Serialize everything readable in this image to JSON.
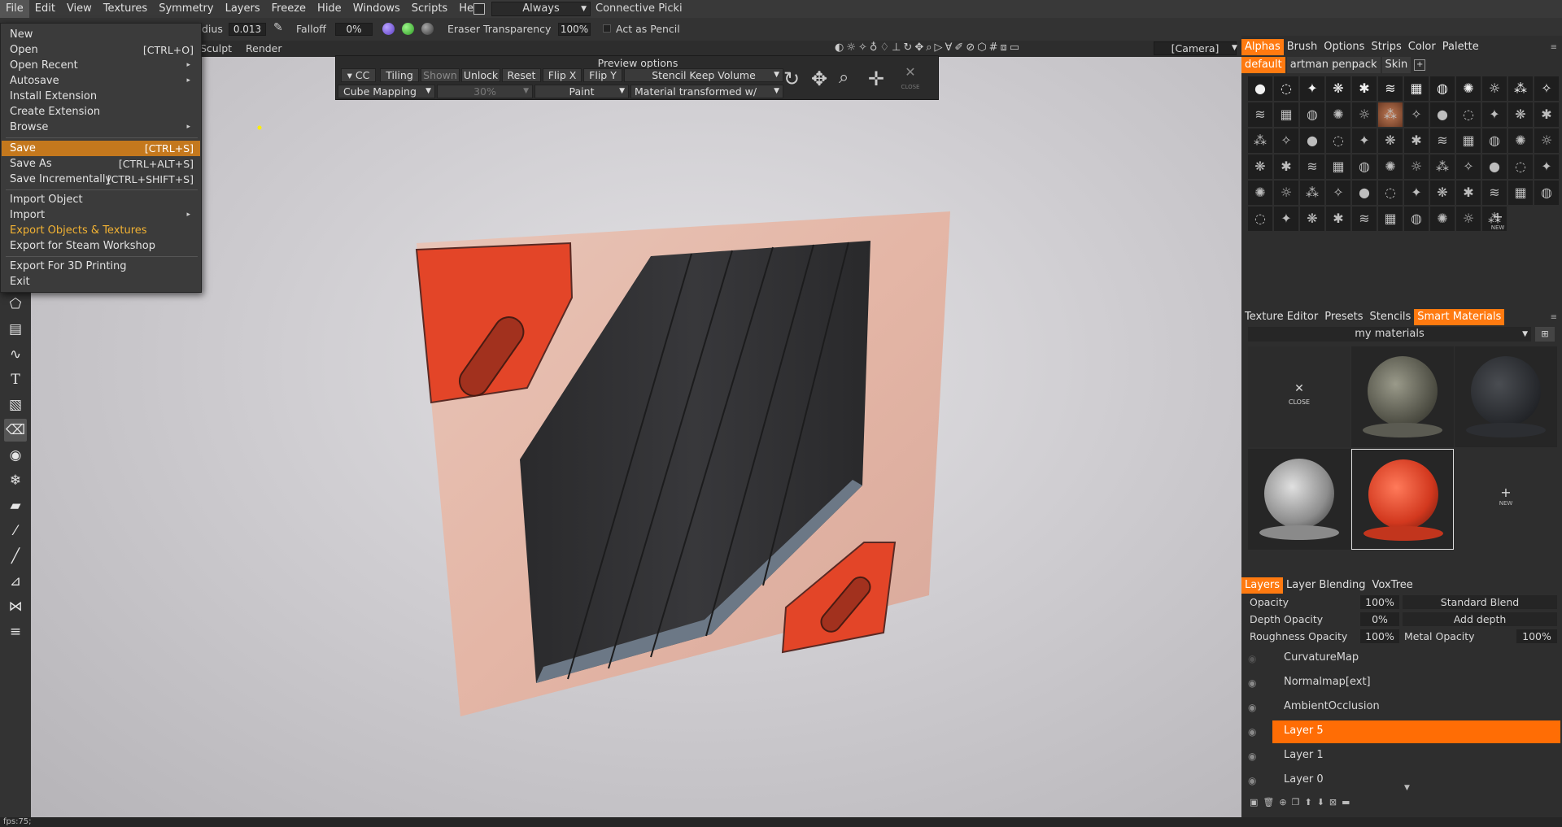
{
  "menubar": [
    "File",
    "Edit",
    "View",
    "Textures",
    "Symmetry",
    "Layers",
    "Freeze",
    "Hide",
    "Windows",
    "Scripts",
    "Help"
  ],
  "toolbar": {
    "always": "Always",
    "connective": "Connective Picki",
    "radius_label": "dius",
    "radius_value": "0.013",
    "falloff_label": "Falloff",
    "falloff_value": "0%",
    "eraser_label": "Eraser Transparency",
    "eraser_value": "100%",
    "pencil_label": "Act as Pencil",
    "camera": "[Camera]",
    "sculpt": "Sculpt",
    "render": "Render"
  },
  "file_menu": {
    "new": "New",
    "open": "Open",
    "open_sc": "[CTRL+O]",
    "open_recent": "Open Recent",
    "autosave": "Autosave",
    "install_ext": "Install Extension",
    "create_ext": "Create Extension",
    "browse": "Browse",
    "save": "Save",
    "save_sc": "[CTRL+S]",
    "save_as": "Save As",
    "save_as_sc": "[CTRL+ALT+S]",
    "save_inc": "Save Incrementally",
    "save_inc_sc": "[CTRL+SHIFT+S]",
    "import_object": "Import Object",
    "import": "Import",
    "export_obj_tex": "Export Objects & Textures",
    "export_steam": "Export for Steam Workshop",
    "export_3d": "Export For 3D Printing",
    "exit": "Exit"
  },
  "preview": {
    "title": "Preview options",
    "cc": "CC",
    "tiling": "Tiling",
    "shown": "Shown",
    "unlock": "Unlock",
    "reset": "Reset",
    "flipx": "Flip X",
    "flipy": "Flip Y",
    "stencil": "Stencil Keep Volume",
    "cube": "Cube Mapping",
    "pct": "30%",
    "paint": "Paint",
    "material": "Material transformed w/",
    "close": "CLOSE"
  },
  "alphas_tabs": [
    "Alphas",
    "Brush",
    "Options",
    "Strips",
    "Color",
    "Palette"
  ],
  "alphas_sets": [
    "default",
    "artman penpack",
    "Skin"
  ],
  "alphas_new": "NEW",
  "materials_tabs": [
    "Texture Editor",
    "Presets",
    "Stencils",
    "Smart Materials"
  ],
  "materials_folder": "my materials",
  "materials_close": "CLOSE",
  "materials_new": "NEW",
  "layers_tabs": [
    "Layers",
    "Layer Blending",
    "VoxTree"
  ],
  "layer_props": {
    "opacity_label": "Opacity",
    "opacity_value": "100%",
    "blend": "Standard Blend",
    "depth_label": "Depth Opacity",
    "depth_value": "0%",
    "depth_mode": "Add depth",
    "rough_label": "Roughness Opacity",
    "rough_value": "100%",
    "metal_label": "Metal Opacity",
    "metal_value": "100%"
  },
  "layers": [
    "CurvatureMap",
    "Normalmap[ext]",
    "AmbientOcclusion",
    "Layer 5",
    "Layer 1",
    "Layer 0"
  ],
  "status": "fps:75;",
  "colors": {
    "accent": "#ff7a10",
    "menu_highlight": "#c4781d",
    "gold": "#f2b233"
  }
}
